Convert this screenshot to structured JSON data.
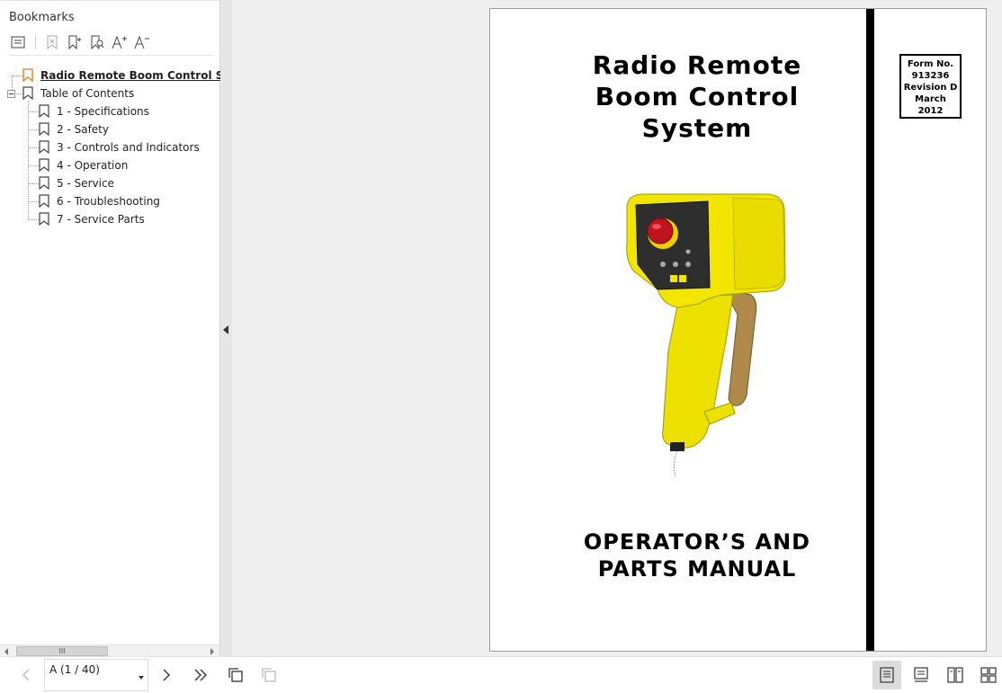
{
  "sidebar": {
    "title": "Bookmarks",
    "toolbar": [
      "outline-menu-icon",
      "delete-bookmark-icon",
      "add-bookmark-icon",
      "find-bookmark-icon",
      "increase-font-icon",
      "decrease-font-icon"
    ],
    "tree": [
      {
        "label": "Radio Remote Boom Control System",
        "selected": true
      },
      {
        "label": "Table of Contents",
        "expanded": true
      },
      {
        "label": "1 - Specifications"
      },
      {
        "label": "2 - Safety"
      },
      {
        "label": "3 - Controls and Indicators"
      },
      {
        "label": "4 - Operation"
      },
      {
        "label": "5 - Service"
      },
      {
        "label": "6 - Troubleshooting"
      },
      {
        "label": "7 - Service Parts"
      }
    ],
    "scroll_grip": "III"
  },
  "document": {
    "title_lines": [
      "Radio Remote",
      "Boom Control",
      "System"
    ],
    "form_box": [
      "Form No.",
      "913236",
      "Revision D",
      "March",
      "2012"
    ],
    "manual_lines": [
      "OPERATOR’S AND",
      "PARTS MANUAL"
    ]
  },
  "bottombar": {
    "page_label": "A (1 / 40)",
    "view_modes": [
      "single-page-icon",
      "continuous-page-icon",
      "two-page-icon",
      "two-page-continuous-icon"
    ],
    "active_view": "single-page-icon"
  },
  "colors": {
    "accent_bookmark": "#e07a1f",
    "viewer_bg": "#efefef",
    "remote_yellow": "#f2e600"
  }
}
